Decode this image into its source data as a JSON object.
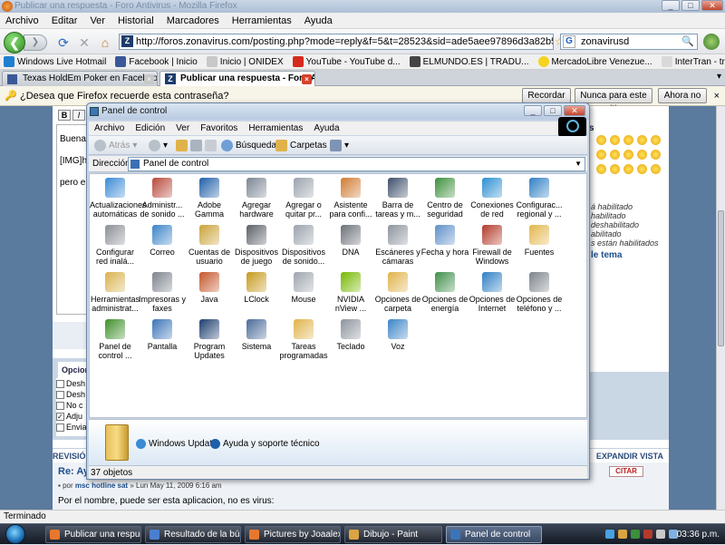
{
  "firefox": {
    "title": "Publicar una respuesta - Foro Antivirus - Mozilla Firefox",
    "window_buttons": [
      "_",
      "□",
      "✕"
    ],
    "menu": [
      "Archivo",
      "Editar",
      "Ver",
      "Historial",
      "Marcadores",
      "Herramientas",
      "Ayuda"
    ],
    "nav": {
      "back": "❮",
      "forward": "❯",
      "reload": "⟳",
      "stop": "✕",
      "home": "⌂"
    },
    "url": "http://foros.zonavirus.com/posting.php?mode=reply&f=5&t=28523&sid=ade5aee97896d3a82b5057c70b31748b",
    "search_value": "zonavirusd",
    "bookmarks": [
      {
        "label": "Windows Live Hotmail",
        "color": "#1f7fd1"
      },
      {
        "label": "Facebook | Inicio",
        "color": "#3b5998"
      },
      {
        "label": "Inicio | ONIDEX",
        "color": "#c8c8c8"
      },
      {
        "label": "YouTube - YouTube d...",
        "color": "#d62a1e"
      },
      {
        "label": "ELMUNDO.ES | TRADU...",
        "color": "#444444"
      },
      {
        "label": "MercadoLibre Venezue...",
        "color": "#f5d31f"
      },
      {
        "label": "InterTran - translation ...",
        "color": "#d9d9d9"
      }
    ],
    "tabs": [
      {
        "label": "Texas HoldEm Poker en Facebook",
        "active": false
      },
      {
        "label": "Publicar una respuesta - Foro Anti...",
        "active": true
      }
    ],
    "tab_close": "×",
    "notification": {
      "text": "¿Desea que Firefox recuerde esta contraseña?",
      "buttons": [
        "Recordar",
        "Nunca para este sitio",
        "Ahora no"
      ],
      "close": "×"
    },
    "status": "Terminado"
  },
  "forum": {
    "editor_bold": "B",
    "editor_italic": "I",
    "post_lines": [
      "Buenas",
      "[IMG]h",
      "pero er"
    ],
    "options_tab": "Opcion",
    "option_rows": [
      {
        "label": "Desh",
        "checked": false
      },
      {
        "label": "Desh",
        "checked": false
      },
      {
        "label": "No c",
        "checked": false
      },
      {
        "label": "Adju",
        "checked": true
      },
      {
        "label": "Envia",
        "checked": false
      }
    ],
    "right_lines": [
      "á habilitado",
      "habilitado",
      "deshabilitado",
      "abilitado",
      "s están habilitados"
    ],
    "right_link": "le tema",
    "review_label": "REVISIÓN D",
    "expand_label": "EXPANDIR VISTA",
    "reply_title": "Re: Ay",
    "reply_meta_prefix": "por",
    "reply_author": "msc hotline sat",
    "reply_date": "» Lun May 11, 2009 6:16 am",
    "quote_button": "CITAR",
    "reply_body": "Por el nombre, puede ser esta aplicacion, no es virus:"
  },
  "control_panel": {
    "title": "Panel de control",
    "window_buttons": [
      "_",
      "□",
      "✕"
    ],
    "menu": [
      "Archivo",
      "Edición",
      "Ver",
      "Favoritos",
      "Herramientas",
      "Ayuda"
    ],
    "toolbar": {
      "back": "Atrás",
      "search": "Búsqueda",
      "folders": "Carpetas"
    },
    "address_label": "Dirección",
    "address_value": "Panel de control",
    "address_dropdown": "▼",
    "items": [
      {
        "label": "Actualizaciones automáticas",
        "icon": "update-icon",
        "color": "#3a8ad6"
      },
      {
        "label": "Administr... de sonido ...",
        "icon": "speaker-icon",
        "color": "#b8483a"
      },
      {
        "label": "Adobe Gamma",
        "icon": "monitor-icon",
        "color": "#1f5fa8"
      },
      {
        "label": "Agregar hardware",
        "icon": "hardware-icon",
        "color": "#7a8593"
      },
      {
        "label": "Agregar o quitar pr...",
        "icon": "programs-icon",
        "color": "#9aa2ac"
      },
      {
        "label": "Asistente para confi...",
        "icon": "house-icon",
        "color": "#d07a32"
      },
      {
        "label": "Barra de tareas y m...",
        "icon": "taskbar-icon",
        "color": "#3e4f6a"
      },
      {
        "label": "Centro de seguridad",
        "icon": "shield-icon",
        "color": "#3c8f3c"
      },
      {
        "label": "Conexiones de red",
        "icon": "network-icon",
        "color": "#2b8fd1"
      },
      {
        "label": "Configurac... regional y ...",
        "icon": "globe-icon",
        "color": "#2f7fc4"
      },
      {
        "label": "Configurar red inalá...",
        "icon": "wireless-icon",
        "color": "#8a8f96"
      },
      {
        "label": "Correo",
        "icon": "mail-icon",
        "color": "#3b84c8"
      },
      {
        "label": "Cuentas de usuario",
        "icon": "users-icon",
        "color": "#c9a238"
      },
      {
        "label": "Dispositivos de juego",
        "icon": "gamepad-icon",
        "color": "#5a5f66"
      },
      {
        "label": "Dispositivos de sonido...",
        "icon": "sound-device-icon",
        "color": "#9aa2ac"
      },
      {
        "label": "DNA",
        "icon": "dna-icon",
        "color": "#6b7078"
      },
      {
        "label": "Escáneres y cámaras",
        "icon": "scanner-icon",
        "color": "#8d949d"
      },
      {
        "label": "Fecha y hora",
        "icon": "clock-icon",
        "color": "#5e8fc9"
      },
      {
        "label": "Firewall de Windows",
        "icon": "firewall-icon",
        "color": "#b33a2a"
      },
      {
        "label": "Fuentes",
        "icon": "fonts-folder-icon",
        "color": "#e3b64c"
      },
      {
        "label": "Herramientas administrat...",
        "icon": "admin-tools-icon",
        "color": "#d9b24e"
      },
      {
        "label": "Impresoras y faxes",
        "icon": "printer-icon",
        "color": "#7d838c"
      },
      {
        "label": "Java",
        "icon": "java-icon",
        "color": "#c4562a"
      },
      {
        "label": "LClock",
        "icon": "lclock-icon",
        "color": "#c79a1e"
      },
      {
        "label": "Mouse",
        "icon": "mouse-icon",
        "color": "#9ea5ad"
      },
      {
        "label": "NVIDIA nView ...",
        "icon": "nvidia-icon",
        "color": "#76b900"
      },
      {
        "label": "Opciones de carpeta",
        "icon": "folder-options-icon",
        "color": "#e0b34a"
      },
      {
        "label": "Opciones de energía",
        "icon": "power-icon",
        "color": "#3f8f4a"
      },
      {
        "label": "Opciones de Internet",
        "icon": "internet-icon",
        "color": "#2f7fc4"
      },
      {
        "label": "Opciones de teléfono y ...",
        "icon": "phone-icon",
        "color": "#7d838c"
      },
      {
        "label": "Panel de control ...",
        "icon": "nvidia-panel-icon",
        "color": "#3f8f2a"
      },
      {
        "label": "Pantalla",
        "icon": "display-icon",
        "color": "#3a74b8"
      },
      {
        "label": "Program Updates",
        "icon": "program-updates-icon",
        "color": "#1d3e6e"
      },
      {
        "label": "Sistema",
        "icon": "system-icon",
        "color": "#4a6a98"
      },
      {
        "label": "Tareas programadas",
        "icon": "tasks-folder-icon",
        "color": "#e0b34a"
      },
      {
        "label": "Teclado",
        "icon": "keyboard-icon",
        "color": "#8d949d"
      },
      {
        "label": "Voz",
        "icon": "voice-icon",
        "color": "#3b84c8"
      }
    ],
    "details_links": [
      "Windows Update",
      "Ayuda y soporte técnico"
    ],
    "status": "37 objetos"
  },
  "taskbar": {
    "tasks": [
      {
        "label": "Publicar una respues...",
        "color": "#e8772e",
        "active": false
      },
      {
        "label": "Resultado de la búsq...",
        "color": "#4a7fd0",
        "active": false
      },
      {
        "label": "Pictures by Joaalexa ...",
        "color": "#e8772e",
        "active": false
      },
      {
        "label": "Dibujo - Paint",
        "color": "#d9a441",
        "active": false
      },
      {
        "label": "Panel de control",
        "color": "#3b74b8",
        "active": true
      }
    ],
    "time": "03:36 p.m."
  }
}
